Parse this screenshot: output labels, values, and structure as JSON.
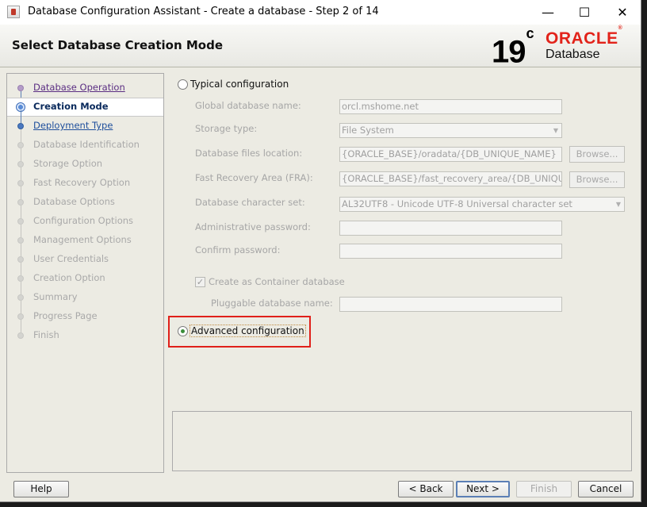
{
  "window": {
    "title": "Database Configuration Assistant - Create a database - Step 2 of 14"
  },
  "header": {
    "page_title": "Select Database Creation Mode",
    "logo_version": "19",
    "logo_version_suffix": "c",
    "logo_brand": "ORACLE",
    "logo_brand_mark": "®",
    "logo_product": "Database"
  },
  "sidebar": {
    "steps": [
      {
        "label": "Database Operation",
        "state": "done"
      },
      {
        "label": "Creation Mode",
        "state": "current"
      },
      {
        "label": "Deployment Type",
        "state": "next"
      },
      {
        "label": "Database Identification",
        "state": "pending"
      },
      {
        "label": "Storage Option",
        "state": "pending"
      },
      {
        "label": "Fast Recovery Option",
        "state": "pending"
      },
      {
        "label": "Database Options",
        "state": "pending"
      },
      {
        "label": "Configuration Options",
        "state": "pending"
      },
      {
        "label": "Management Options",
        "state": "pending"
      },
      {
        "label": "User Credentials",
        "state": "pending"
      },
      {
        "label": "Creation Option",
        "state": "pending"
      },
      {
        "label": "Summary",
        "state": "pending"
      },
      {
        "label": "Progress Page",
        "state": "pending"
      },
      {
        "label": "Finish",
        "state": "pending"
      }
    ]
  },
  "form": {
    "typical_label": "Typical configuration",
    "typical_selected": false,
    "global_db_name_label": "Global database name:",
    "global_db_name_value": "orcl.mshome.net",
    "storage_type_label": "Storage type:",
    "storage_type_value": "File System",
    "db_files_location_label": "Database files location:",
    "db_files_location_value": "{ORACLE_BASE}/oradata/{DB_UNIQUE_NAME}",
    "fra_label": "Fast Recovery Area (FRA):",
    "fra_value": "{ORACLE_BASE}/fast_recovery_area/{DB_UNIQUE_NAME}",
    "browse_label": "Browse...",
    "charset_label": "Database character set:",
    "charset_value": "AL32UTF8 - Unicode UTF-8 Universal character set",
    "admin_password_label": "Administrative password:",
    "confirm_password_label": "Confirm password:",
    "container_db_label": "Create as Container database",
    "container_db_checked": true,
    "pluggable_db_label": "Pluggable database name:",
    "advanced_label": "Advanced configuration",
    "advanced_selected": true
  },
  "buttons": {
    "help": "Help",
    "back": "< Back",
    "next": "Next >",
    "finish": "Finish",
    "cancel": "Cancel"
  },
  "colors": {
    "annotation_box": "#e0201a",
    "oracle_red": "#e2231a",
    "link_purple": "#5a2d82",
    "link_blue": "#1f4f9c"
  }
}
